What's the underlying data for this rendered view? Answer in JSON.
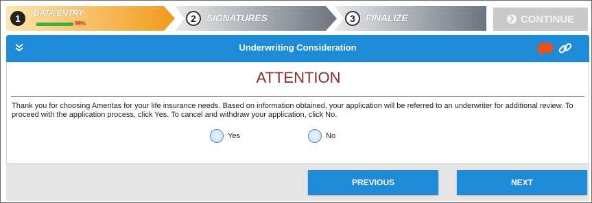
{
  "progress": {
    "steps": [
      {
        "number": "1",
        "label": "DATA ENTRY",
        "percent": "99%"
      },
      {
        "number": "2",
        "label": "SIGNATURES"
      },
      {
        "number": "3",
        "label": "FINALIZE"
      }
    ],
    "continue_label": "CONTINUE",
    "completion_fraction": 0.99
  },
  "header": {
    "title": "Underwriting Consideration",
    "icons": [
      "collapse-chevrons-icon",
      "chat-bubble-icon",
      "link-icon"
    ]
  },
  "content": {
    "heading": "ATTENTION",
    "message": "Thank you for choosing Ameritas for your life insurance needs. Based on information obtained, your application will be referred to an underwriter for additional review. To proceed with the application process, click Yes. To cancel and withdraw your application, click No.",
    "options": [
      {
        "label": "Yes",
        "selected": false
      },
      {
        "label": "No",
        "selected": false
      }
    ]
  },
  "footer": {
    "previous_label": "PREVIOUS",
    "next_label": "NEXT"
  },
  "colors": {
    "accent_blue": "#1e8bd8",
    "step_active_orange": "#f5a623",
    "step_inactive_gray": "#7a828c",
    "heading_red": "#8b2b2b",
    "progress_green": "#3cb043"
  }
}
